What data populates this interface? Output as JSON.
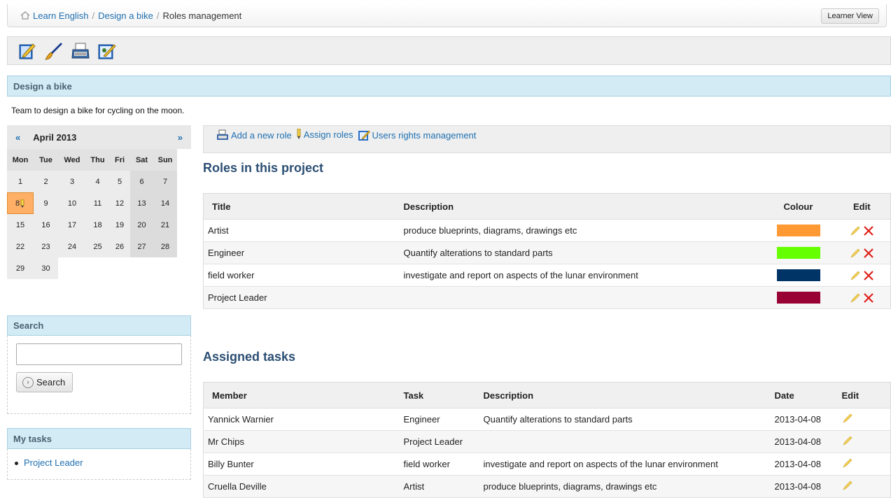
{
  "breadcrumb": {
    "items": [
      "Learn English",
      "Design a bike",
      "Roles management"
    ],
    "learner_view_label": "Learner View"
  },
  "toolbar": {
    "icons": [
      "edit-document-icon",
      "brush-icon",
      "typewriter-icon",
      "edit-users-icon"
    ]
  },
  "page": {
    "title": "Design a bike",
    "description": "Team to design a bike for cycling on the moon."
  },
  "calendar": {
    "month_label": "April 2013",
    "prev": "«",
    "next": "»",
    "weekdays": [
      "Mon",
      "Tue",
      "Wed",
      "Thu",
      "Fri",
      "Sat",
      "Sun"
    ],
    "weeks": [
      [
        "1",
        "2",
        "3",
        "4",
        "5",
        "6",
        "7"
      ],
      [
        "8",
        "9",
        "10",
        "11",
        "12",
        "13",
        "14"
      ],
      [
        "15",
        "16",
        "17",
        "18",
        "19",
        "20",
        "21"
      ],
      [
        "22",
        "23",
        "24",
        "25",
        "26",
        "27",
        "28"
      ],
      [
        "29",
        "30",
        "",
        "",
        "",
        "",
        ""
      ]
    ],
    "today": "8"
  },
  "search": {
    "heading": "Search",
    "button_label": "Search",
    "value": ""
  },
  "my_tasks": {
    "heading": "My tasks",
    "items": [
      "Project Leader"
    ]
  },
  "actions": {
    "add_role": "Add a new role",
    "assign_roles": "Assign roles",
    "users_rights": "Users rights management"
  },
  "roles": {
    "heading": "Roles in this project",
    "columns": [
      "Title",
      "Description",
      "Colour",
      "Edit"
    ],
    "rows": [
      {
        "title": "Artist",
        "description": "produce blueprints, diagrams, drawings etc",
        "colour": "#ff9933"
      },
      {
        "title": "Engineer",
        "description": "Quantify alterations to standard parts",
        "colour": "#66ff00"
      },
      {
        "title": "field worker",
        "description": "investigate and report on aspects of the lunar environment",
        "colour": "#003366"
      },
      {
        "title": "Project Leader",
        "description": "",
        "colour": "#990033"
      }
    ]
  },
  "tasks": {
    "heading": "Assigned tasks",
    "columns": [
      "Member",
      "Task",
      "Description",
      "Date",
      "Edit"
    ],
    "rows": [
      {
        "member": "Yannick Warnier",
        "task": "Engineer",
        "description": "Quantify alterations to standard parts",
        "date": "2013-04-08"
      },
      {
        "member": "Mr Chips",
        "task": "Project Leader",
        "description": "",
        "date": "2013-04-08"
      },
      {
        "member": "Billy Bunter",
        "task": "field worker",
        "description": "investigate and report on aspects of the lunar environment",
        "date": "2013-04-08"
      },
      {
        "member": "Cruella Deville",
        "task": "Artist",
        "description": "produce blueprints, diagrams, drawings etc",
        "date": "2013-04-08"
      }
    ]
  }
}
